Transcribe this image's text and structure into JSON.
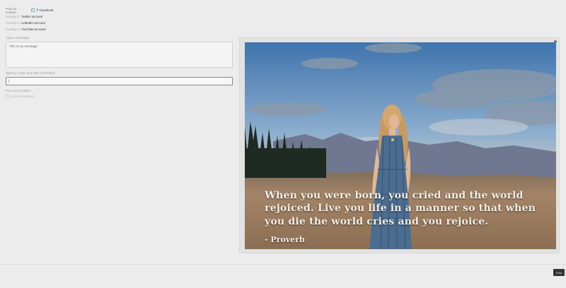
{
  "form": {
    "post_as_label": "Post as custom",
    "facebook_label": "Facebook",
    "accounts": [
      {
        "prefix": "Posting to",
        "name": "Twitter account"
      },
      {
        "prefix": "Posting to",
        "name": "LinkedIn account"
      },
      {
        "prefix": "Posting to",
        "name": "YouTube account"
      }
    ],
    "message_label": "Type a message",
    "message_value": "This is my message",
    "schedule_label": "Specify a date and time (if needed)",
    "schedule_value": "|",
    "post_now_label": "Post now or later?",
    "post_now_checkbox_label": "Post immediately"
  },
  "preview": {
    "quote": "When you were born, you cried and the world rejoiced. Live you life in a manner so that when you die the world cries and you rejoice.",
    "attribution": "- Proverb"
  },
  "footer": {
    "post_button": "Post"
  },
  "colors": {
    "sky_top": "#4a7fb8",
    "sunset": "#f0c9a0",
    "ground": "#a0805e",
    "dress": "#4b6d8f"
  }
}
